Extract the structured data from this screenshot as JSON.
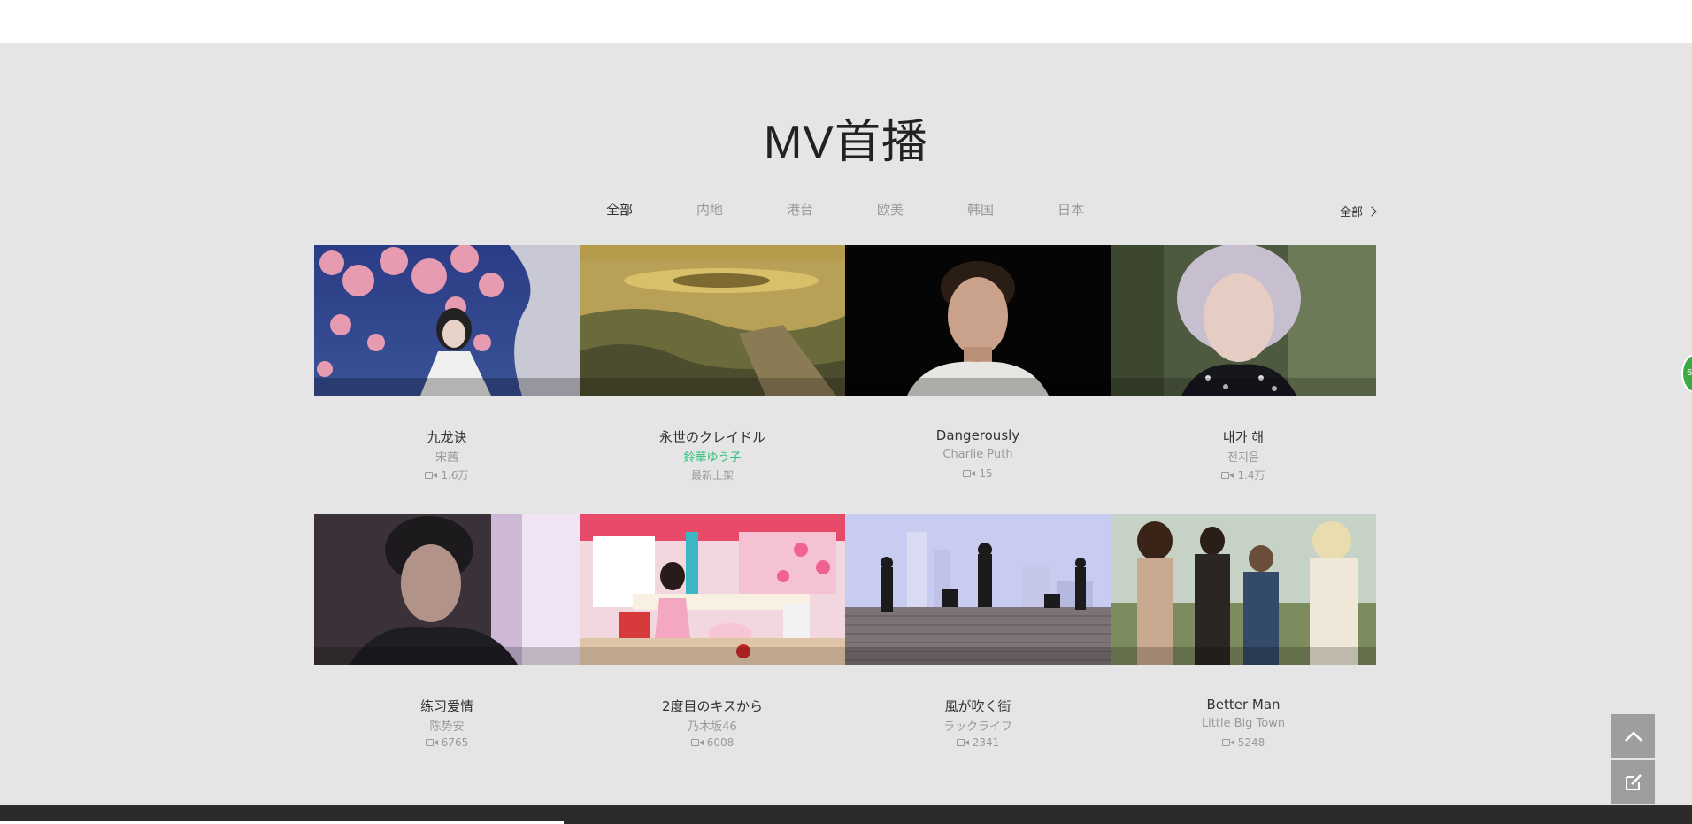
{
  "section": {
    "title": "MV首播",
    "more_label": "全部"
  },
  "tabs": [
    {
      "label": "全部",
      "active": true
    },
    {
      "label": "内地",
      "active": false
    },
    {
      "label": "港台",
      "active": false
    },
    {
      "label": "欧美",
      "active": false
    },
    {
      "label": "韩国",
      "active": false
    },
    {
      "label": "日本",
      "active": false
    }
  ],
  "mvs": [
    {
      "title": "九龙诀",
      "artist": "宋茜",
      "plays": "1.6万",
      "artist_highlight": false
    },
    {
      "title": "永世のクレイドル",
      "artist": "鈴華ゆう子",
      "plays": "最新上架",
      "artist_highlight": true
    },
    {
      "title": "Dangerously",
      "artist": "Charlie Puth",
      "plays": "15",
      "artist_highlight": false
    },
    {
      "title": "내가 해",
      "artist": "전지윤",
      "plays": "1.4万",
      "artist_highlight": false
    },
    {
      "title": "练习爱情",
      "artist": "陈势安",
      "plays": "6765",
      "artist_highlight": false
    },
    {
      "title": "2度目のキスから",
      "artist": "乃木坂46",
      "plays": "6008",
      "artist_highlight": false
    },
    {
      "title": "風が吹く街",
      "artist": "ラックライフ",
      "plays": "2341",
      "artist_highlight": false
    },
    {
      "title": "Better Man",
      "artist": "Little Big Town",
      "plays": "5248",
      "artist_highlight": false
    }
  ],
  "side_buttons": {
    "up_icon": "chevron-up-icon",
    "edit_icon": "edit-icon"
  },
  "edge_badge": "6",
  "colors": {
    "section_bg": "#e5e5e5",
    "accent_green": "#31c27c",
    "footer": "#2b2b2b",
    "side_button": "#9e9e9e"
  }
}
